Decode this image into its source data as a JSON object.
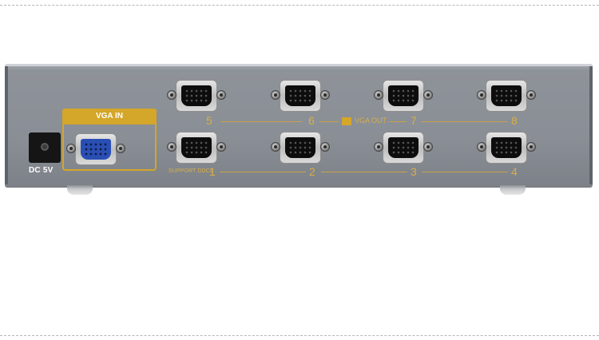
{
  "device": {
    "power": {
      "label": "DC 5V",
      "icon": "dc-power-jack-icon"
    },
    "input": {
      "label": "VGA IN",
      "icon": "vga-input-port-icon",
      "accent": "#d4a629",
      "port_color": "#2a4fb4"
    },
    "outputs": {
      "label": "VGA OUT",
      "support_note": "SUPPORT DDC2",
      "top_row": [
        "5",
        "6",
        "7",
        "8"
      ],
      "bottom_row": [
        "1",
        "2",
        "3",
        "4"
      ],
      "label_color": "#d8af46"
    }
  }
}
